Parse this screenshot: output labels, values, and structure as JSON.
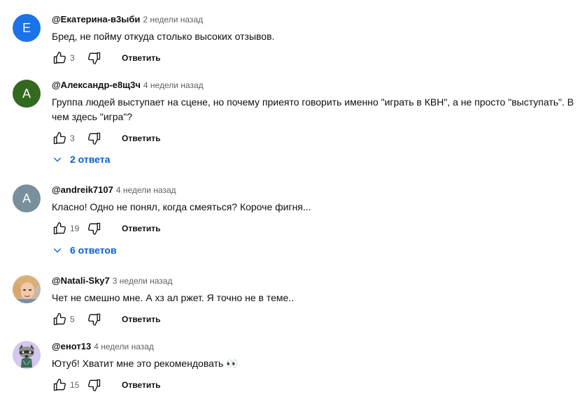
{
  "comments": [
    {
      "author": "@Екатерина-в3ыби",
      "time": "2 недели назад",
      "avatar_letter": "Е",
      "avatar_color": "#1a73e8",
      "text": "Бред, не пойму откуда столько высоких отзывов.",
      "likes": "3",
      "reply_label": "Ответить"
    },
    {
      "author": "@Александр-е8щ3ч",
      "time": "4 недели назад",
      "avatar_letter": "А",
      "avatar_color": "#33691e",
      "text": "Группа людей выступает на сцене, но почему приеято говорить именно \"играть в КВН\", а не просто \"выступать\". В чем здесь \"игра\"?",
      "likes": "3",
      "reply_label": "Ответить",
      "replies_label": "2 ответа"
    },
    {
      "author": "@andreik7107",
      "time": "4 недели назад",
      "avatar_letter": "A",
      "avatar_color": "#78909c",
      "text": "Класно! Одно не понял, когда смеяться? Короче фигня...",
      "likes": "19",
      "reply_label": "Ответить",
      "replies_label": "6 ответов"
    },
    {
      "author": "@Natali-Sky7",
      "time": "3 недели назад",
      "avatar_kind": "photo",
      "text": "Чет не смешно мне. А хз ал ржет. Я точно не в теме..",
      "likes": "5",
      "reply_label": "Ответить"
    },
    {
      "author": "@енот13",
      "time": "4 недели назад",
      "avatar_kind": "raccoon",
      "text": "Ютуб! Хватит мне это рекомендовать 👀",
      "likes": "15",
      "reply_label": "Ответить"
    }
  ],
  "colors": {
    "link_blue": "#065fd4",
    "muted_text": "#606060"
  }
}
